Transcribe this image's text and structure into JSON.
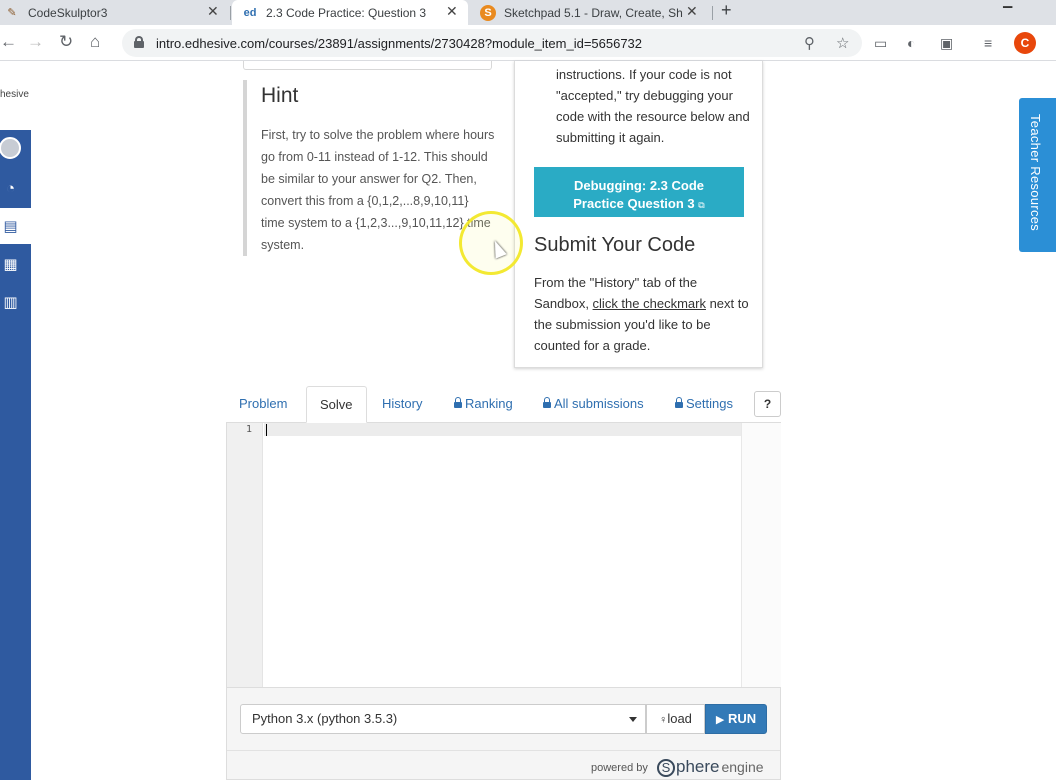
{
  "browser": {
    "tabs": [
      {
        "title": "CodeSkulptor3",
        "favicon": "quill-icon"
      },
      {
        "title": "2.3 Code Practice: Question 3",
        "favicon": "ed",
        "active": true
      },
      {
        "title": "Sketchpad 5.1 - Draw, Create, Sh",
        "favicon": "S"
      }
    ],
    "close_glyph": "✕",
    "new_tab_glyph": "+",
    "url": "intro.edhesive.com/courses/23891/assignments/2730428?module_item_id=5656732",
    "profile_initial": "C",
    "profile_color": "#e8470b"
  },
  "sidebar": {
    "brand_text": "hesive",
    "rail_color": "#2f5aa0",
    "items": [
      "avatar-icon",
      "dashboard-icon",
      "courses-icon",
      "calendar-icon",
      "inbox-icon"
    ]
  },
  "hint": {
    "title": "Hint",
    "text": "First, try to solve the problem where hours go from 0-11 instead of 1-12. This should be similar to your answer for Q2. Then, convert this from a {0,1,2,...8,9,10,11} time system to a {1,2,3...,9,10,11,12} time system."
  },
  "right_card": {
    "instructions_text": "instructions. If your code is not \"accepted,\" try debugging your code with the resource below and submitting it again.",
    "debug_button_line1": "Debugging: 2.3 Code",
    "debug_button_line2": "Practice Question 3",
    "debug_button_color": "#2aabc5",
    "submit_title": "Submit Your Code",
    "submit_text_before": "From the \"History\" tab of the Sandbox, ",
    "submit_link": "click the checkmark",
    "submit_text_after": " next to the submission you'd like to be counted for a grade."
  },
  "editor_tabs": {
    "problem": "Problem",
    "solve": "Solve",
    "history": "History",
    "ranking": "Ranking",
    "all_submissions": "All submissions",
    "settings": "Settings",
    "help": "?"
  },
  "editor": {
    "line_number": "1",
    "code": ""
  },
  "bottom_bar": {
    "language": "Python 3.x (python 3.5.3)",
    "load_label": "load",
    "run_label": "RUN",
    "run_color": "#337ab7",
    "powered_by": "powered by",
    "logo_sphere": "phere",
    "logo_s": "S",
    "logo_engine": "engine"
  },
  "teacher_resources": {
    "label": "Teacher Resources",
    "color": "#2b8fd6"
  }
}
